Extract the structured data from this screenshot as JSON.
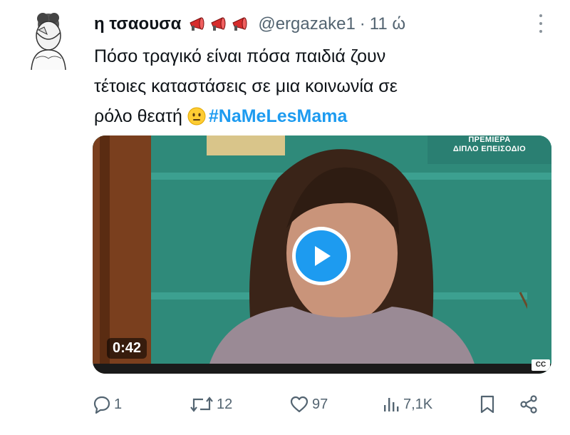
{
  "tweet": {
    "display_name": "η τσαουσα",
    "handle": "@ergazake1",
    "separator": "·",
    "time": "11 ώ",
    "text_lines": [
      "Πόσο τραγικό  είναι πόσα παιδιά ζουν",
      "τέτοιες καταστάσεις σε μια  κοινωνία σε",
      "ρόλο θεατή"
    ],
    "hashtag": "#NaMeLesMama",
    "name_icons": [
      "megaphone-icon",
      "megaphone-icon",
      "megaphone-icon"
    ],
    "text_emoji": "neutral-face-emoji"
  },
  "video": {
    "duration": "0:42",
    "badge_line1": "ΠΡΕΜΙΕΡΑ",
    "badge_line2": "ΔΙΠΛΟ ΕΠΕΙΣΟΔΙΟ",
    "cc_label": "CC"
  },
  "actions": {
    "replies": "1",
    "reposts": "12",
    "likes": "97",
    "views": "7,1K"
  },
  "colors": {
    "accent": "#1d9bf0",
    "secondary_text": "#536471",
    "primary_text": "#0f1419",
    "megaphone": "#d62d2d"
  }
}
